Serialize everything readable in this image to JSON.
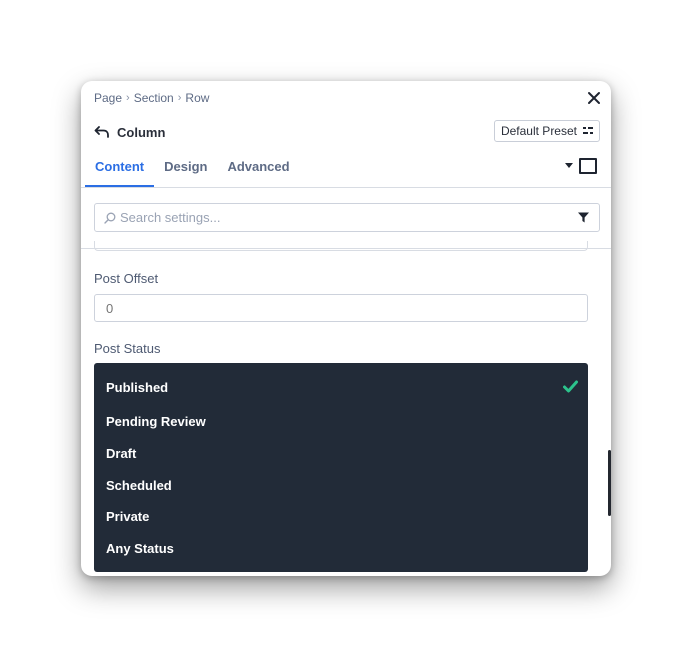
{
  "breadcrumb": {
    "items": [
      "Page",
      "Section",
      "Row"
    ]
  },
  "header": {
    "title": "Column",
    "preset_label": "Default Preset"
  },
  "tabs": [
    {
      "label": "Content",
      "active": true
    },
    {
      "label": "Design",
      "active": false
    },
    {
      "label": "Advanced",
      "active": false
    }
  ],
  "search": {
    "placeholder": "Search settings...",
    "value": ""
  },
  "fields": {
    "post_offset": {
      "label": "Post Offset",
      "placeholder": "0"
    },
    "post_status": {
      "label": "Post Status",
      "selected": "Published",
      "options": [
        "Published",
        "Pending Review",
        "Draft",
        "Scheduled",
        "Private",
        "Any Status"
      ]
    }
  },
  "colors": {
    "accent": "#2b6ee4",
    "dropdown_bg": "#222b38",
    "check": "#2cc38c"
  },
  "icons": [
    "close-icon",
    "back-arrow-icon",
    "preset-icon",
    "caret-down-icon",
    "square-icon",
    "search-icon",
    "filter-icon",
    "checkmark-icon"
  ]
}
